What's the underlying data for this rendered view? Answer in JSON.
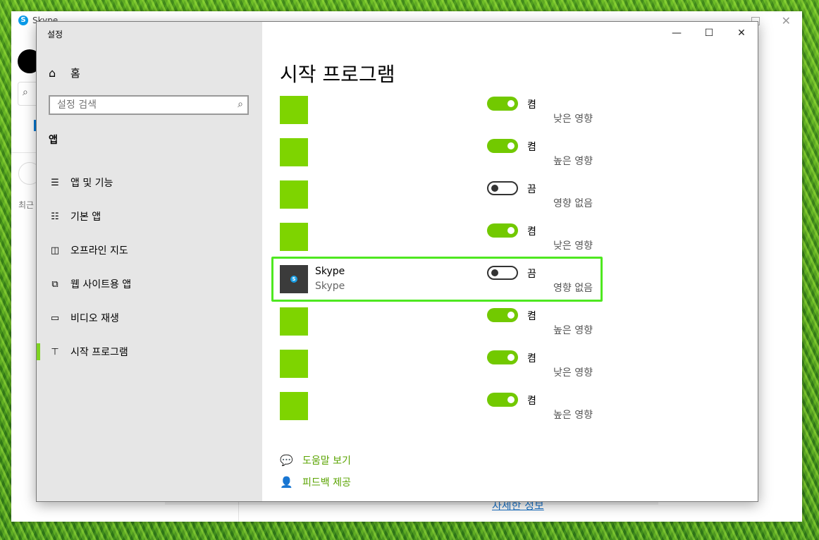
{
  "background_app": {
    "title": "Skype",
    "recent_label": "최근",
    "more_info_link": "자세한 정보"
  },
  "window": {
    "title": "설정",
    "controls": {
      "minimize": "—",
      "maximize": "☐",
      "close": "✕"
    }
  },
  "sidebar": {
    "home_label": "홈",
    "search_placeholder": "설정 검색",
    "section_label": "앱",
    "items": [
      {
        "label": "앱 및 기능",
        "icon": "list-icon"
      },
      {
        "label": "기본 앱",
        "icon": "default-apps-icon"
      },
      {
        "label": "오프라인 지도",
        "icon": "map-icon"
      },
      {
        "label": "웹 사이트용 앱",
        "icon": "open-external-icon"
      },
      {
        "label": "비디오 재생",
        "icon": "video-icon"
      },
      {
        "label": "시작 프로그램",
        "icon": "startup-icon"
      }
    ],
    "active_index": 5
  },
  "main": {
    "page_title": "시작 프로그램",
    "apps": [
      {
        "name": "",
        "publisher": "",
        "enabled": true,
        "state": "켬",
        "impact": "낮은 영향"
      },
      {
        "name": "",
        "publisher": "",
        "enabled": true,
        "state": "켬",
        "impact": "높은 영향"
      },
      {
        "name": "",
        "publisher": "",
        "enabled": false,
        "state": "끔",
        "impact": "영향 없음"
      },
      {
        "name": "",
        "publisher": "",
        "enabled": true,
        "state": "켬",
        "impact": "낮은 영향"
      },
      {
        "name": "Skype",
        "publisher": "Skype",
        "enabled": false,
        "state": "끔",
        "impact": "영향 없음"
      },
      {
        "name": "",
        "publisher": "",
        "enabled": true,
        "state": "켬",
        "impact": "높은 영향"
      },
      {
        "name": "",
        "publisher": "",
        "enabled": true,
        "state": "켬",
        "impact": "낮은 영향"
      },
      {
        "name": "",
        "publisher": "",
        "enabled": true,
        "state": "켬",
        "impact": "높은 영향"
      }
    ],
    "links": {
      "help": "도움말 보기",
      "feedback": "피드백 제공"
    }
  },
  "colors": {
    "accent": "#7ed321",
    "toggle_on": "#72c900",
    "tile": "#7ed400",
    "highlight": "#4ee820",
    "link": "#5aa300"
  }
}
